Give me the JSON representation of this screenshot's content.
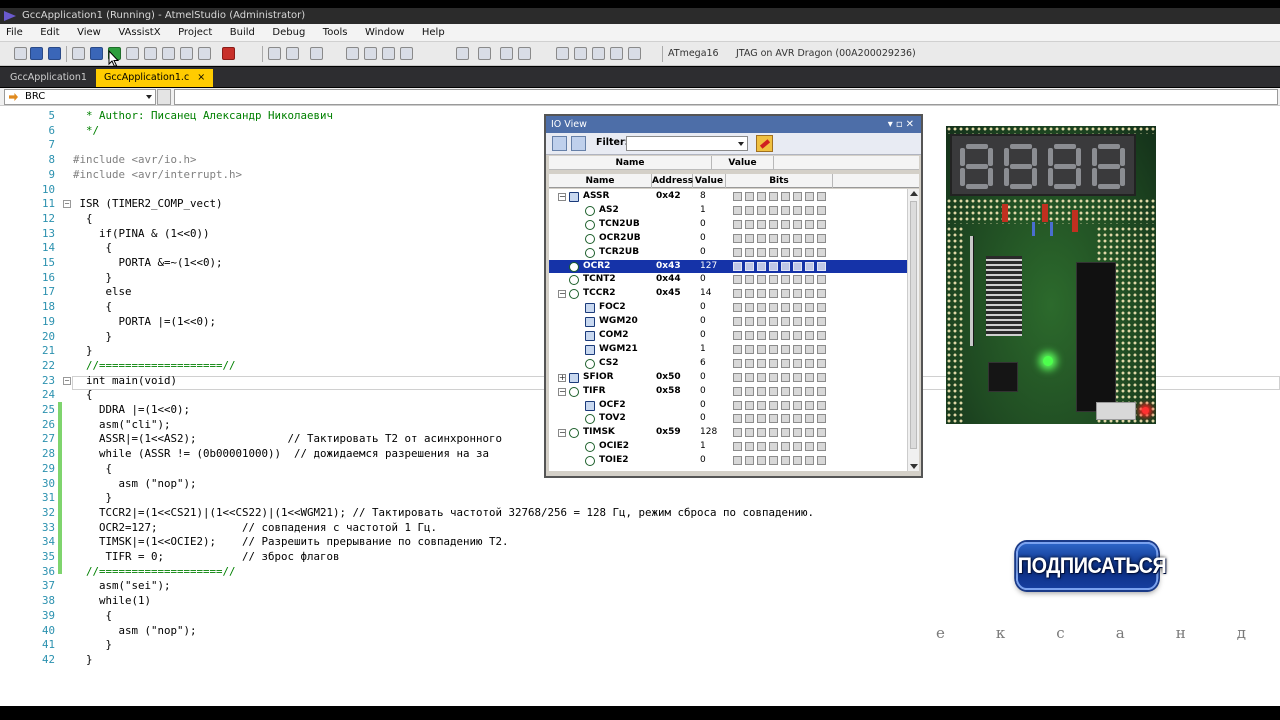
{
  "window": {
    "title": "GccApplication1 (Running) - AtmelStudio (Administrator)"
  },
  "menu": [
    "File",
    "Edit",
    "View",
    "VAssistX",
    "Project",
    "Build",
    "Debug",
    "Tools",
    "Window",
    "Help"
  ],
  "toolbar": {
    "device": "ATmega16",
    "tool": "JTAG on AVR Dragon (00A200029236)"
  },
  "tabs": [
    {
      "label": "GccApplication1",
      "active": false
    },
    {
      "label": "GccApplication1.c",
      "active": true,
      "close": "×"
    }
  ],
  "nav": {
    "combo_value": "BRC"
  },
  "code_lines": [
    {
      "n": "5",
      "t": "  * Author: Писанец Александр Николаевич",
      "cls": "cm"
    },
    {
      "n": "6",
      "t": "  */",
      "cls": "cm"
    },
    {
      "n": "7",
      "t": "",
      "cls": ""
    },
    {
      "n": "8",
      "t": "#include <avr/io.h>",
      "cls": "pp"
    },
    {
      "n": "9",
      "t": "#include <avr/interrupt.h>",
      "cls": "pp"
    },
    {
      "n": "10",
      "t": "",
      "cls": ""
    },
    {
      "n": "11",
      "t": " ISR (TIMER2_COMP_vect)",
      "cls": ""
    },
    {
      "n": "12",
      "t": "  {",
      "cls": ""
    },
    {
      "n": "13",
      "t": "    if(PINA & (1<<0))",
      "cls": ""
    },
    {
      "n": "14",
      "t": "     {",
      "cls": ""
    },
    {
      "n": "15",
      "t": "       PORTA &=~(1<<0);",
      "cls": ""
    },
    {
      "n": "16",
      "t": "     }",
      "cls": ""
    },
    {
      "n": "17",
      "t": "     else",
      "cls": ""
    },
    {
      "n": "18",
      "t": "     {",
      "cls": ""
    },
    {
      "n": "19",
      "t": "       PORTA |=(1<<0);",
      "cls": ""
    },
    {
      "n": "20",
      "t": "     }",
      "cls": ""
    },
    {
      "n": "21",
      "t": "  }",
      "cls": ""
    },
    {
      "n": "22",
      "t": "  //===================//",
      "cls": "cm"
    },
    {
      "n": "23",
      "t": "  int main(void)",
      "cls": ""
    },
    {
      "n": "24",
      "t": "  {",
      "cls": ""
    },
    {
      "n": "25",
      "t": "    DDRA |=(1<<0);",
      "cls": ""
    },
    {
      "n": "26",
      "t": "    asm(\"cli\");",
      "cls": ""
    },
    {
      "n": "27",
      "t": "    ASSR|=(1<<AS2);              // Тактировать Т2 от асинхронного",
      "cls": ""
    },
    {
      "n": "28",
      "t": "    while (ASSR != (0b00001000))  // дожидаемся разрешения на за",
      "cls": ""
    },
    {
      "n": "29",
      "t": "     {",
      "cls": ""
    },
    {
      "n": "30",
      "t": "       asm (\"nop\");",
      "cls": ""
    },
    {
      "n": "31",
      "t": "     }",
      "cls": ""
    },
    {
      "n": "32",
      "t": "    TCCR2|=(1<<CS21)|(1<<CS22)|(1<<WGM21); // Тактировать частотой 32768/256 = 128 Гц, режим сброса по совпадению.",
      "cls": ""
    },
    {
      "n": "33",
      "t": "    OCR2=127;             // совпадения с частотой 1 Гц.",
      "cls": ""
    },
    {
      "n": "34",
      "t": "    TIMSK|=(1<<OCIE2);    // Разрешить прерывание по совпадению Т2.",
      "cls": ""
    },
    {
      "n": "35",
      "t": "     TIFR = 0;            // зброс флагов",
      "cls": ""
    },
    {
      "n": "36",
      "t": "  //===================//",
      "cls": "cm"
    },
    {
      "n": "37",
      "t": "    asm(\"sei\");",
      "cls": ""
    },
    {
      "n": "38",
      "t": "    while(1)",
      "cls": ""
    },
    {
      "n": "39",
      "t": "     {",
      "cls": ""
    },
    {
      "n": "40",
      "t": "       asm (\"nop\");",
      "cls": ""
    },
    {
      "n": "41",
      "t": "     }",
      "cls": ""
    },
    {
      "n": "42",
      "t": "  }",
      "cls": ""
    }
  ],
  "ioview": {
    "title": "IO View",
    "filter_label": "Filter:",
    "filter_value": "",
    "header_top": {
      "name": "Name",
      "value": "Value"
    },
    "header_cols": {
      "name": "Name",
      "address": "Address",
      "value": "Value",
      "bits": "Bits"
    },
    "rows": [
      {
        "name": "ASSR",
        "address": "0x42",
        "value": "8",
        "level": 0,
        "expander": "−",
        "icon": "reg",
        "selected": false
      },
      {
        "name": "AS2",
        "address": "",
        "value": "1",
        "level": 1,
        "expander": "",
        "icon": "bit",
        "selected": false
      },
      {
        "name": "TCN2UB",
        "address": "",
        "value": "0",
        "level": 1,
        "expander": "",
        "icon": "bit",
        "selected": false
      },
      {
        "name": "OCR2UB",
        "address": "",
        "value": "0",
        "level": 1,
        "expander": "",
        "icon": "bit",
        "selected": false
      },
      {
        "name": "TCR2UB",
        "address": "",
        "value": "0",
        "level": 1,
        "expander": "",
        "icon": "bit",
        "selected": false
      },
      {
        "name": "OCR2",
        "address": "0x43",
        "value": "127",
        "level": 0,
        "expander": "",
        "icon": "bit",
        "selected": true
      },
      {
        "name": "TCNT2",
        "address": "0x44",
        "value": "0",
        "level": 0,
        "expander": "",
        "icon": "bit",
        "selected": false
      },
      {
        "name": "TCCR2",
        "address": "0x45",
        "value": "14",
        "level": 0,
        "expander": "−",
        "icon": "bit",
        "selected": false
      },
      {
        "name": "FOC2",
        "address": "",
        "value": "0",
        "level": 1,
        "expander": "",
        "icon": "reg",
        "selected": false
      },
      {
        "name": "WGM20",
        "address": "",
        "value": "0",
        "level": 1,
        "expander": "",
        "icon": "reg",
        "selected": false
      },
      {
        "name": "COM2",
        "address": "",
        "value": "0",
        "level": 1,
        "expander": "",
        "icon": "reg",
        "selected": false
      },
      {
        "name": "WGM21",
        "address": "",
        "value": "1",
        "level": 1,
        "expander": "",
        "icon": "reg",
        "selected": false
      },
      {
        "name": "CS2",
        "address": "",
        "value": "6",
        "level": 1,
        "expander": "",
        "icon": "bit",
        "selected": false
      },
      {
        "name": "SFIOR",
        "address": "0x50",
        "value": "0",
        "level": 0,
        "expander": "+",
        "icon": "reg",
        "selected": false
      },
      {
        "name": "TIFR",
        "address": "0x58",
        "value": "0",
        "level": 0,
        "expander": "−",
        "icon": "bit",
        "selected": false
      },
      {
        "name": "OCF2",
        "address": "",
        "value": "0",
        "level": 1,
        "expander": "",
        "icon": "reg",
        "selected": false
      },
      {
        "name": "TOV2",
        "address": "",
        "value": "0",
        "level": 1,
        "expander": "",
        "icon": "bit",
        "selected": false
      },
      {
        "name": "TIMSK",
        "address": "0x59",
        "value": "128",
        "level": 0,
        "expander": "−",
        "icon": "bit",
        "selected": false
      },
      {
        "name": "OCIE2",
        "address": "",
        "value": "1",
        "level": 1,
        "expander": "",
        "icon": "bit",
        "selected": false
      },
      {
        "name": "TOIE2",
        "address": "",
        "value": "0",
        "level": 1,
        "expander": "",
        "icon": "bit",
        "selected": false
      }
    ]
  },
  "overlay": {
    "subscribe_label": "ПОДПИСАТЬСЯ",
    "spaced_letters": [
      "е",
      "к",
      "с",
      "а",
      "н",
      "д"
    ]
  },
  "colors": {
    "selection": "#1533a8",
    "tab_active": "#ffcc00",
    "accent_blue": "#0a2d84"
  }
}
